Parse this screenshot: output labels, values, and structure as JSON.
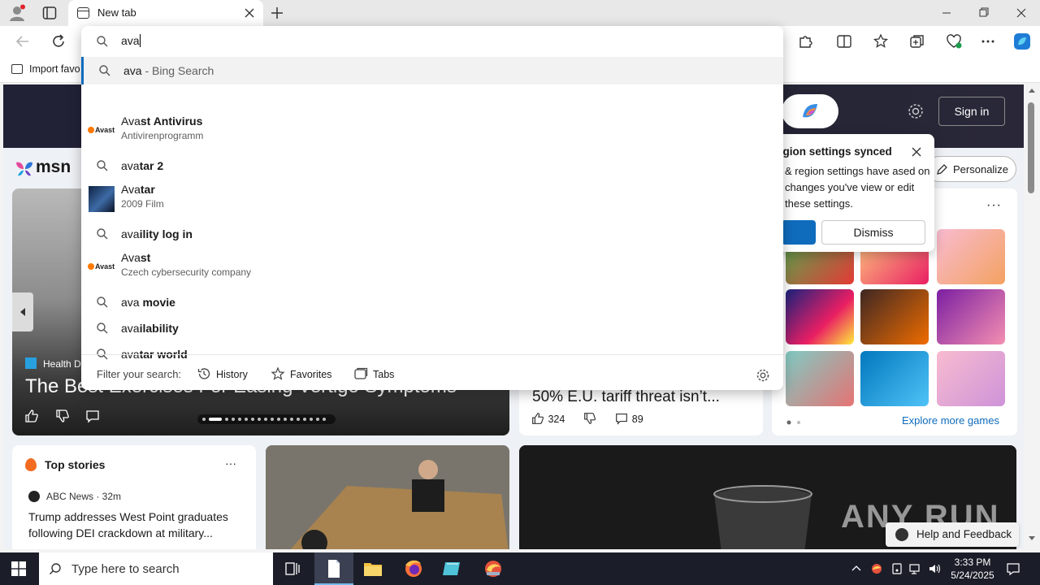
{
  "browser": {
    "tab_title": "New tab",
    "favorites_bar_item": "Import favo"
  },
  "omnibox": {
    "typed_text": "ava",
    "suggestions": [
      {
        "type": "search",
        "typed": "ava",
        "rest": " - Bing Search",
        "active": true
      },
      {
        "type": "entity",
        "typed": "Ava",
        "rest": "st Antivirus",
        "subtitle": "Antivirenprogramm",
        "icon": "avast-logo"
      },
      {
        "type": "search",
        "typed": "ava",
        "rest": "tar 2"
      },
      {
        "type": "entity",
        "typed": "Ava",
        "rest": "tar",
        "subtitle": "2009 Film",
        "icon": "avatar-thumbnail"
      },
      {
        "type": "search",
        "typed": "ava",
        "rest": "ility log in"
      },
      {
        "type": "entity",
        "typed": "Ava",
        "rest": "st",
        "subtitle": "Czech cybersecurity company",
        "icon": "avast-logo"
      },
      {
        "type": "search",
        "typed": "ava",
        "rest": " movie"
      },
      {
        "type": "search",
        "typed": "ava",
        "rest": "ilability"
      },
      {
        "type": "search",
        "typed": "ava",
        "rest": "tar world"
      }
    ],
    "filter_label": "Filter your search:",
    "filters": [
      "History",
      "Favorites",
      "Tabs"
    ]
  },
  "page": {
    "sign_in": "Sign in",
    "msn_logo_text": "msn",
    "personalize": "Personalize",
    "hero": {
      "source": "Health D",
      "title": "The Best Exercises For Easing Vertigo Symptoms"
    },
    "mid_card": {
      "title": "50% E.U. tariff threat isn’t...",
      "likes": "324",
      "comments": "89"
    },
    "games": {
      "explore": "Explore more games"
    },
    "top_stories": {
      "title": "Top stories",
      "source": "ABC News · 32m",
      "headline": "Trump addresses West Point graduates following DEI crackdown at military..."
    },
    "region_popup": {
      "title": "egion settings synced",
      "body": "& region settings have ased on changes you've view or edit these settings.",
      "dismiss": "Dismiss"
    },
    "help_feedback": "Help and Feedback",
    "watermark": "ANY RUN"
  },
  "taskbar": {
    "search_placeholder": "Type here to search",
    "time": "3:33 PM",
    "date": "5/24/2025"
  },
  "colors": {
    "accent": "#0f6cbd",
    "taskbar": "#1b1e29",
    "suggestion_hover": "#f2f2f2"
  }
}
